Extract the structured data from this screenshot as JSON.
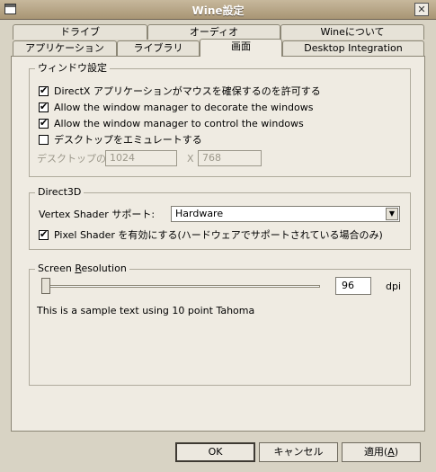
{
  "window": {
    "title": "Wine設定"
  },
  "tabs_back": [
    "ドライブ",
    "オーディオ",
    "Wineについて"
  ],
  "tabs_front": [
    "アプリケーション",
    "ライブラリ",
    "画面",
    "Desktop Integration"
  ],
  "window_settings": {
    "group_title": "ウィンドウ設定",
    "options": [
      {
        "label": "DirectX アプリケーションがマウスを確保するのを許可する",
        "checked": true
      },
      {
        "label": "Allow the window manager to decorate the windows",
        "checked": true
      },
      {
        "label": "Allow the window manager to control the windows",
        "checked": true
      },
      {
        "label": "デスクトップをエミュレートする",
        "checked": false
      }
    ],
    "desktop_size_label": "デスクトップの大き",
    "desktop_width": "1024",
    "desktop_x": "X",
    "desktop_height": "768"
  },
  "direct3d": {
    "group_title": "Direct3D",
    "vertex_shader_label": "Vertex Shader サポート:",
    "vertex_shader_value": "Hardware",
    "pixel_shader_label": "Pixel Shader を有効にする(ハードウェアでサポートされている場合のみ)",
    "pixel_shader_checked": true
  },
  "resolution": {
    "group_title_pre": "Screen ",
    "group_title_mnemonic": "R",
    "group_title_post": "esolution",
    "dpi_value": "96",
    "dpi_unit": "dpi",
    "sample_text": "This is a sample text using 10 point Tahoma",
    "slider_fraction": 0.0
  },
  "buttons": {
    "ok": "OK",
    "cancel": "キャンセル",
    "apply_pre": "適用(",
    "apply_mnemonic": "A",
    "apply_post": ")"
  }
}
